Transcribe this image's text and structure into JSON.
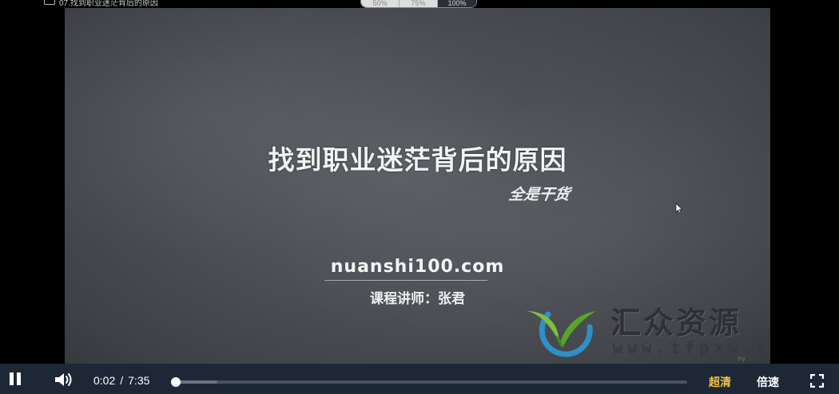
{
  "window": {
    "title": "07.找到职业迷茫背后的原因",
    "zoom_options": [
      "50%",
      "75%",
      "100%"
    ],
    "zoom_active": "100%"
  },
  "slide": {
    "title": "找到职业迷茫背后的原因",
    "subtitle": "全是干货",
    "site": "nuanshi100.com",
    "instructor": "课程讲师：张君"
  },
  "watermark": {
    "title": "汇众资源",
    "url": "www.tfpxw.com",
    "small_text": "try"
  },
  "player": {
    "current_time": "0:02",
    "separator": "/",
    "duration": "7:35",
    "progress_fraction": 0.0044,
    "buffered_fraction": 0.085,
    "quality_label": "超清",
    "speed_label": "倍速",
    "icons": [
      "pause-icon",
      "volume-icon",
      "fullscreen-icon"
    ],
    "colors": {
      "bar": "#1d2735",
      "quality": "#f1c34a",
      "played": "#ffffff",
      "track": "#4a5260"
    }
  }
}
